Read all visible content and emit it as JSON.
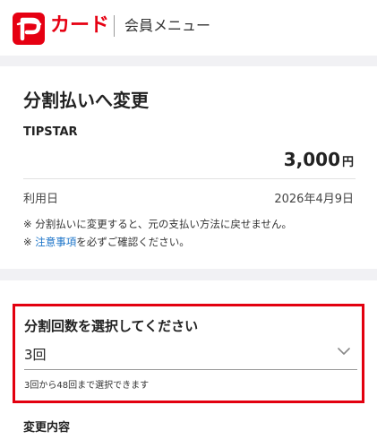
{
  "header": {
    "brand": "カード",
    "menu_link": "会員メニュー",
    "brand_color": "#e60012"
  },
  "change": {
    "title": "分割払いへ変更",
    "merchant": "TIPSTAR",
    "amount": "3,000",
    "currency": "円",
    "use_date_label": "利用日",
    "use_date": "2026年4月9日",
    "note1": "※ 分割払いに変更すると、元の支払い方法に戻せません。",
    "note2_prefix": "※ ",
    "note2_link": "注意事項",
    "note2_suffix": "を必ずご確認ください。"
  },
  "installments": {
    "label": "分割回数を選択してください",
    "selected": "3回",
    "helper": "3回から48回まで選択できます",
    "highlight_color": "#e3000f"
  },
  "details": {
    "title": "変更内容"
  }
}
